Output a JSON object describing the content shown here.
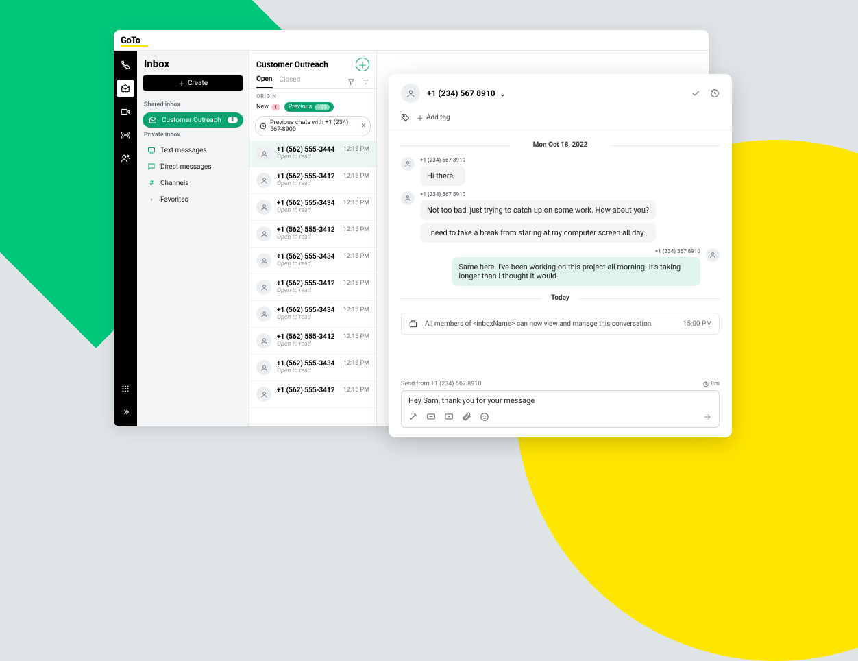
{
  "brand": "GoTo",
  "sidebar": {
    "title": "Inbox",
    "create_label": "Create",
    "shared_label": "Shared inbox",
    "private_label": "Private inbox",
    "shared_items": [
      {
        "label": "Customer Outreach",
        "badge": "1"
      }
    ],
    "private_items": [
      {
        "label": "Text messages"
      },
      {
        "label": "Direct messages"
      },
      {
        "label": "Channels"
      },
      {
        "label": "Favorites"
      }
    ]
  },
  "convlist": {
    "title": "Customer Outreach",
    "tabs": {
      "open": "Open",
      "closed": "Closed"
    },
    "origin_label": "ORIGIN",
    "new_label": "New",
    "new_count": "1",
    "prev_label": "Previous",
    "prev_count": "+99",
    "chip_label": "Previous chats with +1 (234) 567-8900",
    "items": [
      {
        "number": "+1 (562) 555-3444",
        "sub": "Open to read",
        "time": "12:15 PM"
      },
      {
        "number": "+1 (562) 555-3412",
        "sub": "Open to read",
        "time": "12:15 PM"
      },
      {
        "number": "+1 (562) 555-3434",
        "sub": "Open to read",
        "time": "12:15 PM"
      },
      {
        "number": "+1 (562) 555-3412",
        "sub": "Open to read",
        "time": "12:15 PM"
      },
      {
        "number": "+1 (562) 555-3434",
        "sub": "Open to read",
        "time": "12:15 PM"
      },
      {
        "number": "+1 (562) 555-3412",
        "sub": "Open to read",
        "time": "12:15 PM"
      },
      {
        "number": "+1 (562) 555-3434",
        "sub": "Open to read",
        "time": "12:15 PM"
      },
      {
        "number": "+1 (562) 555-3412",
        "sub": "Open to read",
        "time": "12:15 PM"
      },
      {
        "number": "+1 (562) 555-3434",
        "sub": "Open to read",
        "time": "12:15 PM"
      },
      {
        "number": "+1 (562) 555-3412",
        "sub": "Open to read",
        "time": "12:15 PM"
      }
    ]
  },
  "detail": {
    "contact": "+1 (234) 567 8910",
    "add_tag_label": "Add tag",
    "date1": "Mon Oct 18, 2022",
    "from_them": "+1 (234) 567 8910",
    "messages": {
      "m1": "Hi there",
      "m2": "Not too bad, just trying to catch up on some work. How about you?",
      "m3": "I need to take a break from staring at my computer screen all day.",
      "from_me": "+1 (234) 567 8910",
      "m4": "Same here. I've been working on this project all morning. It's taking longer than I thought it would"
    },
    "date2": "Today",
    "notice": "All members of <inboxName> can now view and manage this conversation.",
    "notice_time": "15:00 PM",
    "composer": {
      "from_label": "Send from +1 (234) 567 8910",
      "timer": "8m",
      "value": "Hey Sam, thank you for your message"
    }
  }
}
